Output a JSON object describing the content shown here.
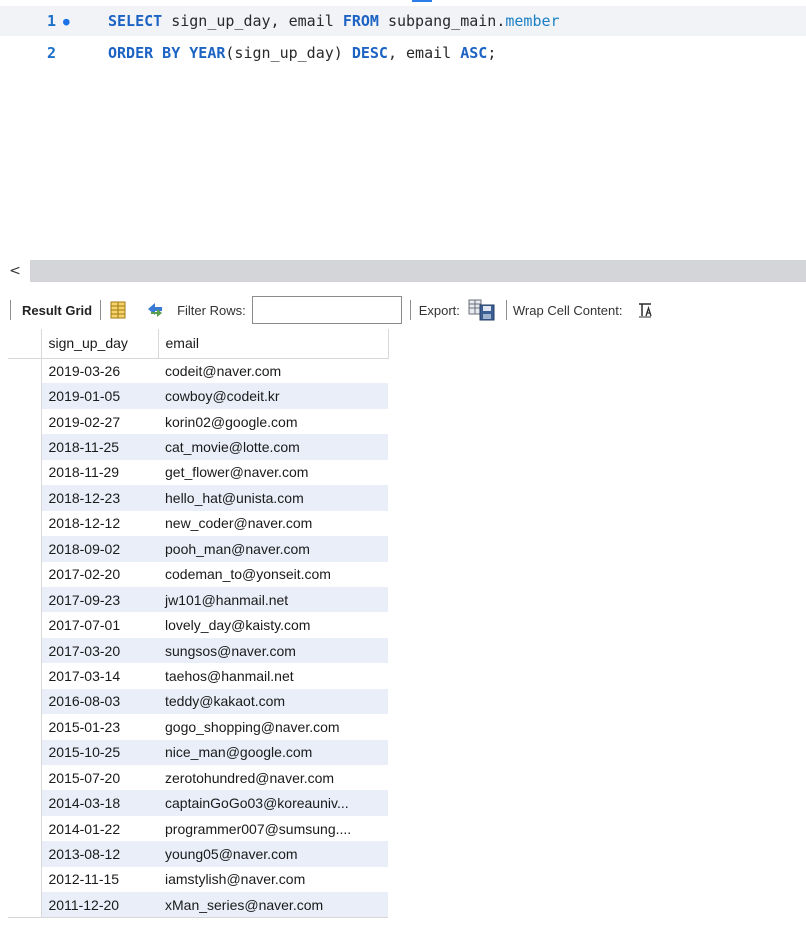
{
  "editor": {
    "lines": [
      {
        "number": "1",
        "marker": "●",
        "tokens": [
          {
            "t": "SELECT",
            "c": "kw"
          },
          {
            "t": " sign_up_day, email ",
            "c": ""
          },
          {
            "t": "FROM",
            "c": "kw"
          },
          {
            "t": " subpang_main.",
            "c": ""
          },
          {
            "t": "member",
            "c": "tbl"
          }
        ]
      },
      {
        "number": "2",
        "marker": "",
        "tokens": [
          {
            "t": "ORDER BY",
            "c": "kw"
          },
          {
            "t": " ",
            "c": ""
          },
          {
            "t": "YEAR",
            "c": "fn"
          },
          {
            "t": "(sign_up_day) ",
            "c": ""
          },
          {
            "t": "DESC",
            "c": "kw"
          },
          {
            "t": ", email ",
            "c": ""
          },
          {
            "t": "ASC",
            "c": "kw"
          },
          {
            "t": ";",
            "c": ""
          }
        ]
      }
    ]
  },
  "scrollbar": {
    "left_arrow": "<"
  },
  "toolbar": {
    "result_grid_label": "Result Grid",
    "filter_label": "Filter Rows:",
    "filter_value": "",
    "export_label": "Export:",
    "wrap_label": "Wrap Cell Content:"
  },
  "table": {
    "columns": [
      "sign_up_day",
      "email"
    ],
    "rows": [
      [
        "2019-03-26",
        "codeit@naver.com"
      ],
      [
        "2019-01-05",
        "cowboy@codeit.kr"
      ],
      [
        "2019-02-27",
        "korin02@google.com"
      ],
      [
        "2018-11-25",
        "cat_movie@lotte.com"
      ],
      [
        "2018-11-29",
        "get_flower@naver.com"
      ],
      [
        "2018-12-23",
        "hello_hat@unista.com"
      ],
      [
        "2018-12-12",
        "new_coder@naver.com"
      ],
      [
        "2018-09-02",
        "pooh_man@naver.com"
      ],
      [
        "2017-02-20",
        "codeman_to@yonseit.com"
      ],
      [
        "2017-09-23",
        "jw101@hanmail.net"
      ],
      [
        "2017-07-01",
        "lovely_day@kaisty.com"
      ],
      [
        "2017-03-20",
        "sungsos@naver.com"
      ],
      [
        "2017-03-14",
        "taehos@hanmail.net"
      ],
      [
        "2016-08-03",
        "teddy@kakaot.com"
      ],
      [
        "2015-01-23",
        "gogo_shopping@naver.com"
      ],
      [
        "2015-10-25",
        "nice_man@google.com"
      ],
      [
        "2015-07-20",
        "zerotohundred@naver.com"
      ],
      [
        "2014-03-18",
        "captainGoGo03@koreauniv..."
      ],
      [
        "2014-01-22",
        "programmer007@sumsung...."
      ],
      [
        "2013-08-12",
        "young05@naver.com"
      ],
      [
        "2012-11-15",
        "iamstylish@naver.com"
      ],
      [
        "2011-12-20",
        "xMan_series@naver.com"
      ]
    ]
  }
}
